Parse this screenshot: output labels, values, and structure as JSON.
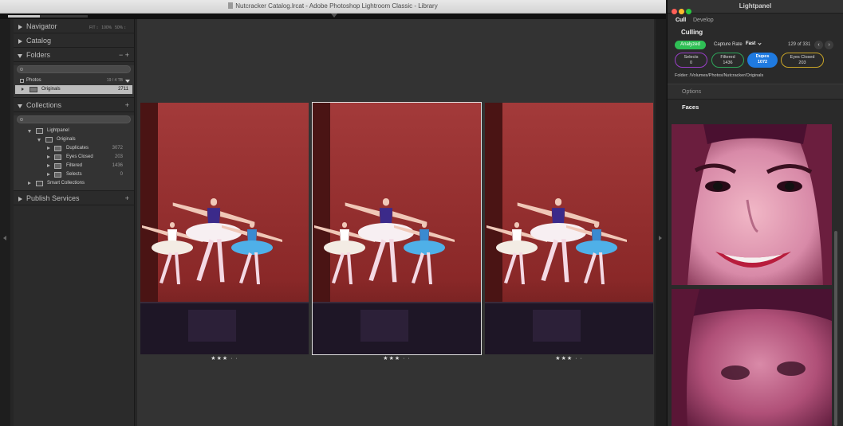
{
  "window": {
    "title": "Nutcracker Catalog.lrcat - Adobe Photoshop Lightroom Classic - Library",
    "progress": 0.4
  },
  "left_panel": {
    "navigator": {
      "label": "Navigator",
      "zoom_options": [
        "FIT ↕",
        "100%",
        "50% ↕"
      ]
    },
    "catalog": {
      "label": "Catalog"
    },
    "folders": {
      "label": "Folders",
      "actions": "−  +",
      "volume": {
        "name": "Photos",
        "info": "19 / 4 TB"
      },
      "items": [
        {
          "name": "Originals",
          "count": "2711"
        }
      ]
    },
    "collections": {
      "label": "Collections",
      "action": "+",
      "tree": [
        {
          "name": "Lightpanel",
          "count": ""
        },
        {
          "name": "Originals",
          "count": ""
        },
        {
          "name": "Duplicates",
          "count": "3072"
        },
        {
          "name": "Eyes Closed",
          "count": "203"
        },
        {
          "name": "Filtered",
          "count": "1436"
        },
        {
          "name": "Selects",
          "count": "0"
        },
        {
          "name": "Smart Collections",
          "count": ""
        }
      ]
    },
    "publish": {
      "label": "Publish Services",
      "action": "+"
    }
  },
  "grid": {
    "photos": [
      {
        "rating": "★★★ · ·",
        "selected": false
      },
      {
        "rating": "★★★ · ·",
        "selected": true
      },
      {
        "rating": "★★★ · ·",
        "selected": false
      }
    ]
  },
  "lightpanel": {
    "title": "Lightpanel",
    "tabs": [
      "Cull",
      "Develop"
    ],
    "active_tab": "Cull",
    "section": "Culling",
    "analyzed_label": "Analyzed",
    "capture_rate_label": "Capture Rate",
    "capture_rate_value": "Fast",
    "counter": "129 of 331",
    "chips": [
      {
        "label": "Selects",
        "count": "0"
      },
      {
        "label": "Filtered",
        "count": "1436"
      },
      {
        "label": "Dupes",
        "count": "1072"
      },
      {
        "label": "Eyes Closed",
        "count": "203"
      }
    ],
    "folder_label": "Folder:",
    "folder_path": "/Volumes/Photos/Nutcracker/Originals",
    "options_label": "Options",
    "faces_label": "Faces"
  },
  "colors": {
    "analyzed": "#2fbf55",
    "selects_border": "#9b3fc9",
    "filtered_border": "#2ea55a",
    "dupes_fill": "#1f7ae0",
    "eyes_border": "#c9a527",
    "traffic_red": "#ff5f57",
    "traffic_yellow": "#febc2e",
    "traffic_green": "#28c840"
  }
}
